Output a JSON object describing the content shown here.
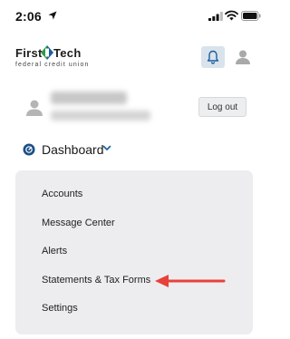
{
  "status": {
    "time": "2:06"
  },
  "brand": {
    "word1": "First",
    "word2": "Tech",
    "tagline": "federal credit union",
    "colors": {
      "green": "#2e9a44",
      "blue": "#1b5e9e"
    }
  },
  "header": {
    "bell_icon": "bell-icon",
    "user_icon": "user-icon"
  },
  "profile": {
    "logout_label": "Log out"
  },
  "nav": {
    "dashboard_label": "Dashboard"
  },
  "menu": {
    "items": [
      {
        "label": "Accounts"
      },
      {
        "label": "Message Center"
      },
      {
        "label": "Alerts"
      },
      {
        "label": "Statements & Tax Forms"
      },
      {
        "label": "Settings"
      }
    ]
  },
  "annotation": {
    "arrow_color": "#e8413a"
  }
}
